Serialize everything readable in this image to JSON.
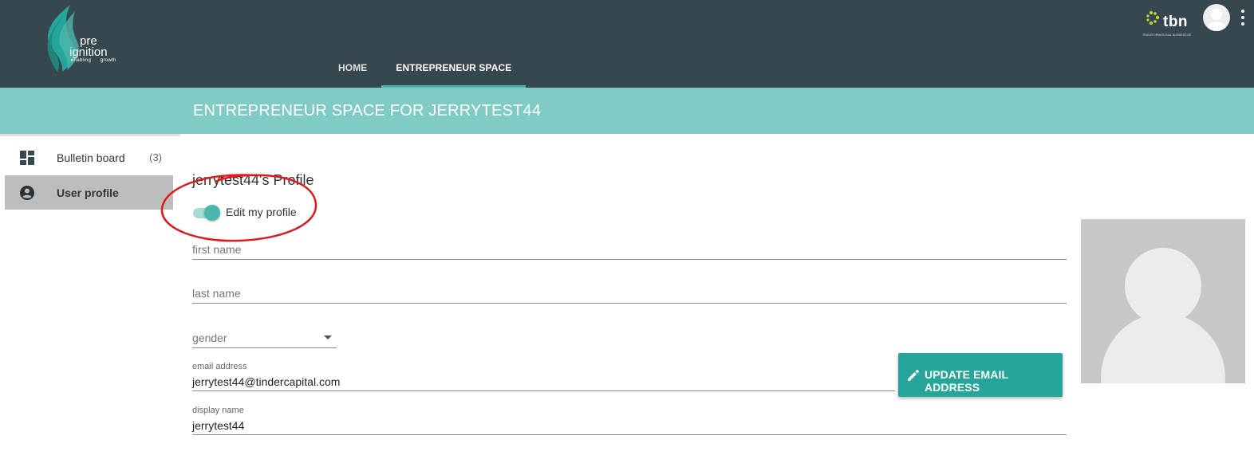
{
  "header": {
    "logo": {
      "line1": "pre",
      "line2": "ignition",
      "tagline": "enabling      growth"
    },
    "nav_tabs": [
      {
        "label": "HOME",
        "active": false
      },
      {
        "label": "ENTREPRENEUR SPACE",
        "active": true
      }
    ],
    "partner_logo": {
      "name": "tbn",
      "subtitle": "TRANSFORMATIONAL BUSINESS NETWORK"
    },
    "avatar_icon": "account-circle-icon",
    "menu_icon": "more-vert-icon"
  },
  "band": {
    "title": "ENTREPRENEUR SPACE FOR JERRYTEST44"
  },
  "sidebar": {
    "items": [
      {
        "label": "Bulletin board",
        "count": "(3)",
        "icon": "dashboard-icon",
        "active": false
      },
      {
        "label": "User profile",
        "count": "",
        "icon": "account-circle-icon",
        "active": true
      }
    ]
  },
  "profile": {
    "title": "jerrytest44's Profile",
    "edit_toggle": {
      "label": "Edit my profile",
      "on": true
    },
    "first_name": {
      "placeholder": "first name",
      "value": ""
    },
    "last_name": {
      "placeholder": "last name",
      "value": ""
    },
    "gender": {
      "placeholder": "gender",
      "value": ""
    },
    "email": {
      "label": "email address",
      "value": "jerrytest44@tindercapital.com"
    },
    "display_name": {
      "label": "display name",
      "value": "jerrytest44"
    },
    "update_email_button": {
      "label": "UPDATE EMAIL ADDRESS",
      "icon": "pencil-icon"
    }
  },
  "colors": {
    "topbar": "#37474f",
    "band": "#80cbc4",
    "accent": "#26a69a",
    "annotation": "#e0191f"
  }
}
